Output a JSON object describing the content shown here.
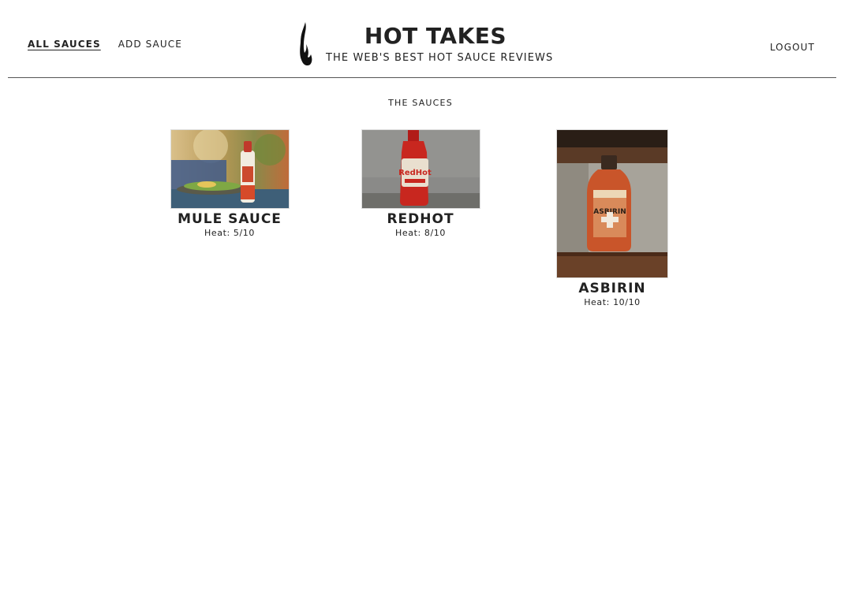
{
  "nav": {
    "all_sauces": "ALL SAUCES",
    "add_sauce": "ADD SAUCE",
    "logout": "LOGOUT"
  },
  "brand": {
    "title": "HOT TAKES",
    "subtitle": "THE WEB'S BEST HOT SAUCE REVIEWS",
    "logo_icon": "flame-icon"
  },
  "main": {
    "section_title": "THE SAUCES",
    "sauces": [
      {
        "name": "MULE SAUCE",
        "heat": "Heat: 5/10",
        "label_text": ""
      },
      {
        "name": "REDHOT",
        "heat": "Heat: 8/10",
        "label_text": "RedHot"
      },
      {
        "name": "ASBIRIN",
        "heat": "Heat: 10/10",
        "label_text": "ASBIRIN"
      }
    ]
  },
  "colors": {
    "text": "#222222",
    "divider": "#555555",
    "background": "#ffffff"
  }
}
